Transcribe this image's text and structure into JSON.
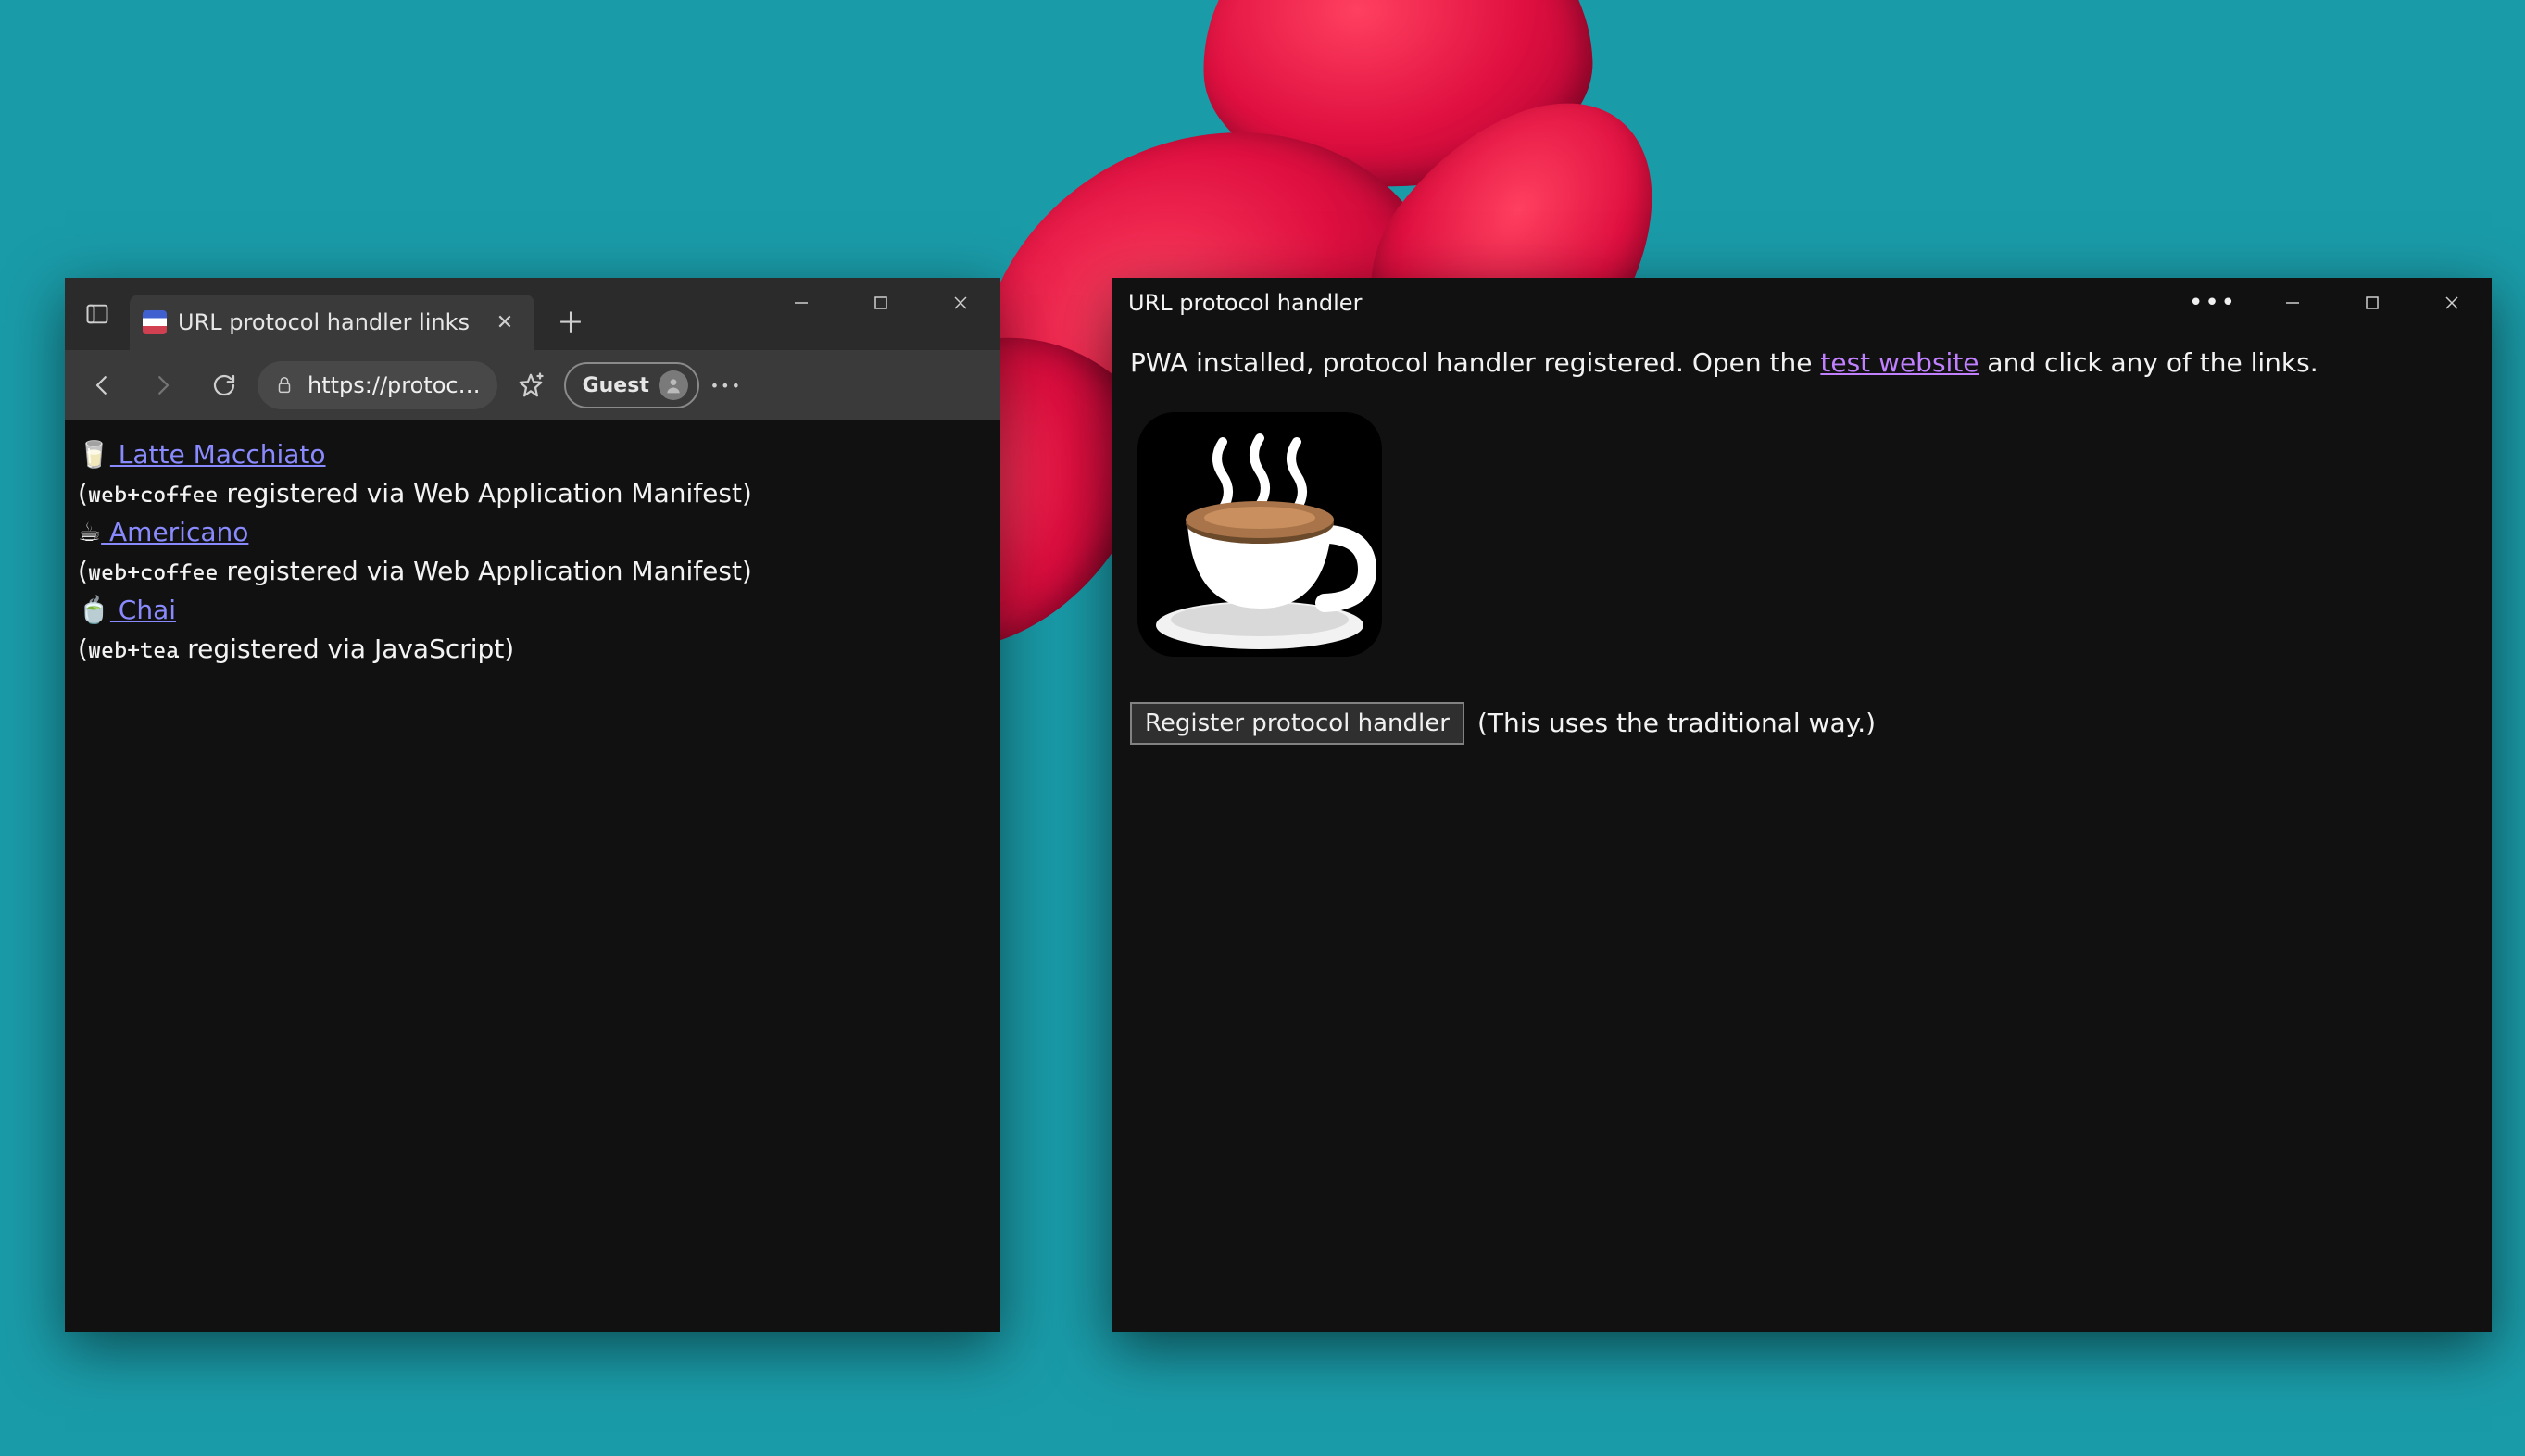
{
  "browser": {
    "tab_title": "URL protocol handler links",
    "address": "https://protoc…",
    "profile_label": "Guest",
    "links": [
      {
        "emoji": "🥛",
        "label": "  Latte Macchiato",
        "detail_prefix": "(",
        "protocol": "web+coffee",
        "detail_suffix": " registered via Web Application Manifest)"
      },
      {
        "emoji": "☕",
        "label": "  Americano",
        "detail_prefix": "(",
        "protocol": "web+coffee",
        "detail_suffix": " registered via Web Application Manifest)"
      },
      {
        "emoji": "🍵",
        "label": "  Chai",
        "detail_prefix": "(",
        "protocol": "web+tea",
        "detail_suffix": " registered via JavaScript)"
      }
    ]
  },
  "app": {
    "title": "URL protocol handler",
    "status_prefix": "PWA installed, protocol handler registered. Open the ",
    "status_link": "test website",
    "status_suffix": " and click any of the links.",
    "button_label": "Register protocol handler",
    "button_note": "(This uses the traditional way.)"
  }
}
